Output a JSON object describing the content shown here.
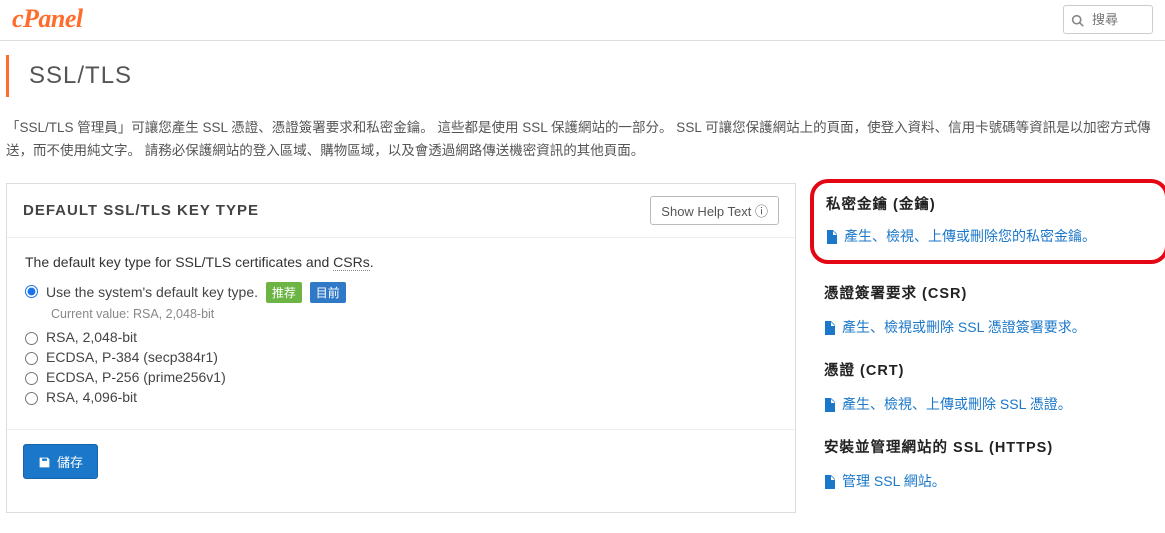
{
  "header": {
    "logo_text": "cPanel",
    "search_placeholder": "搜尋"
  },
  "page_title": "SSL/TLS",
  "intro_text": "「SSL/TLS 管理員」可讓您產生 SSL 憑證、憑證簽署要求和私密金鑰。 這些都是使用 SSL 保護網站的一部分。 SSL 可讓您保護網站上的頁面，使登入資料、信用卡號碼等資訊是以加密方式傳送，而不使用純文字。 請務必保護網站的登入區域、購物區域，以及會透過網路傳送機密資訊的其他頁面。",
  "panel": {
    "title": "DEFAULT SSL/TLS KEY TYPE",
    "help_btn": "Show Help Text ⓘ",
    "subdesc_a": "The default key type for SSL/TLS certificates and ",
    "subdesc_csrs": "CSRs",
    "subdesc_b": ".",
    "options": [
      {
        "label": "Use the system's default key type.",
        "checked": true,
        "tag1": "推荐",
        "tag2": "目前"
      },
      {
        "label": "RSA, 2,048-bit"
      },
      {
        "label": "ECDSA, P-384 (secp384r1)"
      },
      {
        "label": "ECDSA, P-256 (prime256v1)"
      },
      {
        "label": "RSA, 4,096-bit"
      }
    ],
    "current_value": "Current value: RSA, 2,048-bit",
    "save_label": "儲存"
  },
  "sidebar": {
    "sections": [
      {
        "title": "私密金鑰 (金鑰)",
        "link": "產生、檢視、上傳或刪除您的私密金鑰。",
        "highlight": true
      },
      {
        "title": "憑證簽署要求 (CSR)",
        "link": "產生、檢視或刪除 SSL 憑證簽署要求。"
      },
      {
        "title": "憑證 (CRT)",
        "link": "產生、檢視、上傳或刪除 SSL 憑證。"
      },
      {
        "title": "安裝並管理網站的 SSL (HTTPS)",
        "link": "管理 SSL 網站。"
      }
    ]
  }
}
